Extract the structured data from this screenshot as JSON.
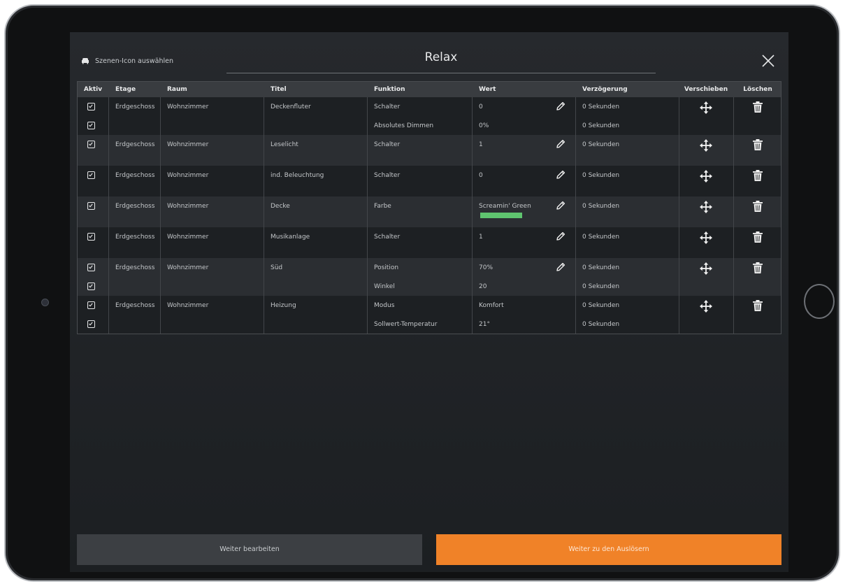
{
  "header": {
    "scene_icon_label": "Szenen-Icon auswählen",
    "title": "Relax"
  },
  "table": {
    "columns": [
      "Aktiv",
      "Etage",
      "Raum",
      "Titel",
      "Funktion",
      "Wert",
      "Verzögerung",
      "Verschieben",
      "Löschen"
    ],
    "groups": [
      {
        "etage": "Erdgeschoss",
        "raum": "Wohnzimmer",
        "titel": "Deckenfluter",
        "rows": [
          {
            "aktiv": true,
            "funktion": "Schalter",
            "wert": "0",
            "verzoegerung": "0 Sekunden",
            "editable": true
          },
          {
            "aktiv": true,
            "funktion": "Absolutes Dimmen",
            "wert": "0%",
            "verzoegerung": "0 Sekunden",
            "editable": false
          }
        ]
      },
      {
        "etage": "Erdgeschoss",
        "raum": "Wohnzimmer",
        "titel": "Leselicht",
        "rows": [
          {
            "aktiv": true,
            "funktion": "Schalter",
            "wert": "1",
            "verzoegerung": "0 Sekunden",
            "editable": true
          }
        ]
      },
      {
        "etage": "Erdgeschoss",
        "raum": "Wohnzimmer",
        "titel": "ind. Beleuchtung",
        "rows": [
          {
            "aktiv": true,
            "funktion": "Schalter",
            "wert": "0",
            "verzoegerung": "0 Sekunden",
            "editable": true
          }
        ]
      },
      {
        "etage": "Erdgeschoss",
        "raum": "Wohnzimmer",
        "titel": "Decke",
        "rows": [
          {
            "aktiv": true,
            "funktion": "Farbe",
            "wert": "Screamin' Green",
            "verzoegerung": "0 Sekunden",
            "editable": true,
            "swatch_color": "#5fc46f"
          }
        ]
      },
      {
        "etage": "Erdgeschoss",
        "raum": "Wohnzimmer",
        "titel": "Musikanlage",
        "rows": [
          {
            "aktiv": true,
            "funktion": "Schalter",
            "wert": "1",
            "verzoegerung": "0 Sekunden",
            "editable": true
          }
        ]
      },
      {
        "etage": "Erdgeschoss",
        "raum": "Wohnzimmer",
        "titel": "Süd",
        "rows": [
          {
            "aktiv": true,
            "funktion": "Position",
            "wert": "70%",
            "verzoegerung": "0 Sekunden",
            "editable": true
          },
          {
            "aktiv": true,
            "funktion": "Winkel",
            "wert": "20",
            "verzoegerung": "0 Sekunden",
            "editable": false
          }
        ]
      },
      {
        "etage": "Erdgeschoss",
        "raum": "Wohnzimmer",
        "titel": "Heizung",
        "rows": [
          {
            "aktiv": true,
            "funktion": "Modus",
            "wert": "Komfort",
            "verzoegerung": "0 Sekunden",
            "editable": false
          },
          {
            "aktiv": true,
            "funktion": "Sollwert-Temperatur",
            "wert": "21°",
            "verzoegerung": "0 Sekunden",
            "editable": false
          }
        ]
      }
    ]
  },
  "footer": {
    "edit_label": "Weiter bearbeiten",
    "next_label": "Weiter zu den Auslösern"
  },
  "colors": {
    "accent": "#f08228",
    "header_row": "#393c40"
  },
  "icons": [
    "armchair-icon",
    "close-icon",
    "checkbox-checked-icon",
    "pencil-icon",
    "move-arrows-icon",
    "trash-icon"
  ]
}
